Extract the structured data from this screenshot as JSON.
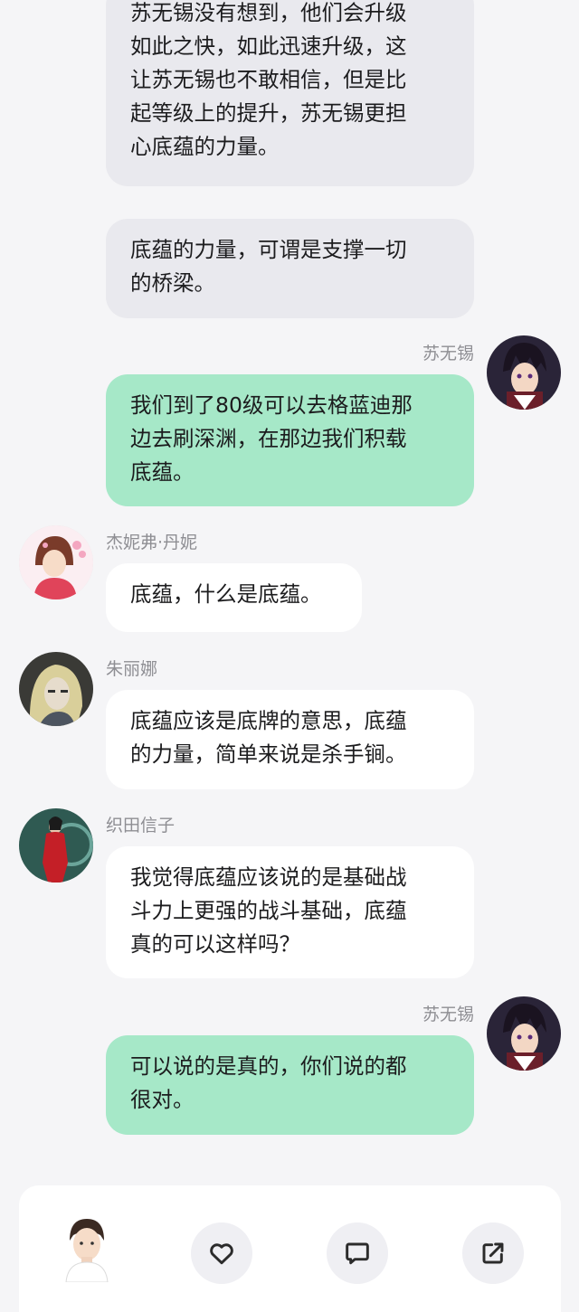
{
  "messages": [
    {
      "sender": "",
      "side": "left",
      "style": "gray",
      "lines": [
        "苏无锡没有想到，他们会升级",
        "如此之快，如此迅速升级，这",
        "让苏无锡也不敢相信，但是比",
        "起等级上的提升，苏无锡更担",
        "心底蕴的力量。"
      ]
    },
    {
      "sender": "",
      "side": "left",
      "style": "gray",
      "lines": [
        "底蕴的力量，可谓是支撑一切",
        "的桥梁。"
      ]
    },
    {
      "sender": "苏无锡",
      "side": "right",
      "style": "green",
      "lines": [
        "我们到了80级可以去格蓝迪那",
        "边去刷深渊，在那边我们积载",
        "底蕴。"
      ]
    },
    {
      "sender": "杰妮弗·丹妮",
      "side": "left",
      "style": "white",
      "lines": [
        "底蕴，什么是底蕴。"
      ]
    },
    {
      "sender": "朱丽娜",
      "side": "left",
      "style": "white",
      "lines": [
        "底蕴应该是底牌的意思，底蕴",
        "的力量，简单来说是杀手锏。"
      ]
    },
    {
      "sender": "织田信子",
      "side": "left",
      "style": "white",
      "lines": [
        "我觉得底蕴应该说的是基础战",
        "斗力上更强的战斗基础，底蕴",
        "真的可以这样吗？"
      ]
    },
    {
      "sender": "苏无锡",
      "side": "right",
      "style": "green",
      "lines": [
        "可以说的是真的，你们说的都",
        "很对。"
      ]
    }
  ],
  "bottom_bar": {
    "buttons": [
      "heart-icon",
      "comment-icon",
      "share-icon"
    ]
  },
  "colors": {
    "background": "#f5f5f7",
    "bubble_gray": "#e9e9ee",
    "bubble_white": "#ffffff",
    "bubble_green": "#a6e8c8",
    "name_text": "#8e8e93"
  }
}
